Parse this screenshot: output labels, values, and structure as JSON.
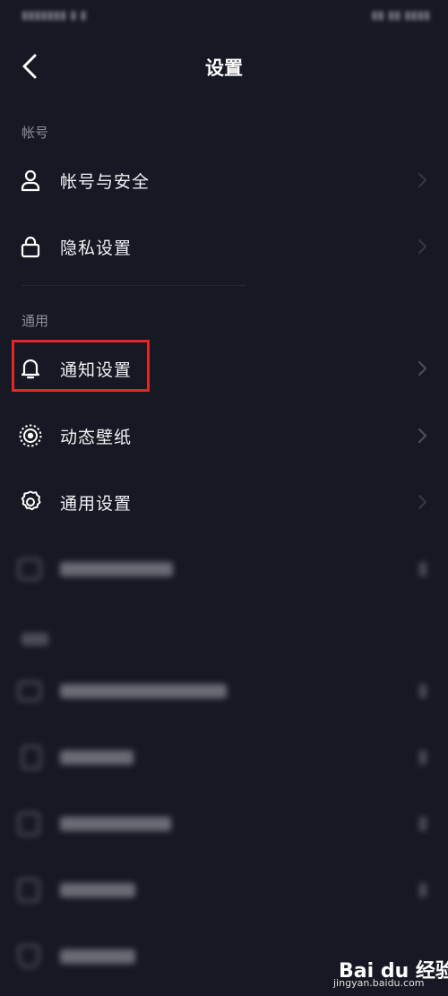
{
  "header": {
    "title": "设置",
    "back_icon": "chevron-left-icon"
  },
  "sections": {
    "account": {
      "label": "帐号",
      "items": [
        {
          "label": "帐号与安全",
          "icon": "user-icon"
        },
        {
          "label": "隐私设置",
          "icon": "lock-icon"
        }
      ]
    },
    "general": {
      "label": "通用",
      "items": [
        {
          "label": "通知设置",
          "icon": "bell-icon"
        },
        {
          "label": "动态壁纸",
          "icon": "live-wallpaper-icon"
        },
        {
          "label": "通用设置",
          "icon": "gear-icon"
        }
      ]
    }
  },
  "highlight_color": "#e4262b",
  "background_color": "#161823",
  "watermark": {
    "brand": "Bai du 经验",
    "url": "jingyan.baidu.com"
  }
}
